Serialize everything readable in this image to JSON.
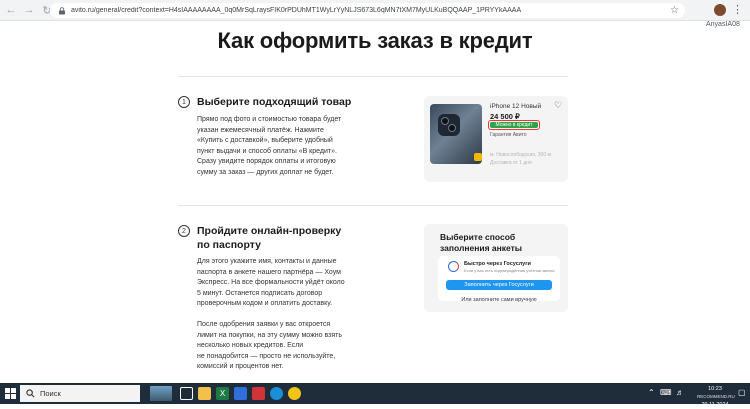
{
  "browser": {
    "url": "avito.ru/general/credit?context=H4sIAAAAAAAA_0q0MrSqLraysFIK0rPDUhMT1WyLrYyNLJS673L6qMN7tXM7MyULKuBQQAAP_1PRYYkAAAA",
    "profile_label": "AnyasIA08"
  },
  "page": {
    "title": "Как оформить заказ в кредит"
  },
  "steps": [
    {
      "number": "1",
      "title": "Выберите подходящий товар",
      "lines": [
        "Прямо под фото и стоимостью товара будет",
        "указан ежемесячный платёж. Нажмите",
        "«Купить с доставкой», выберите удобный",
        "пункт выдачи и способ оплаты «В кредит».",
        "Сразу увидите порядок оплаты и итоговую",
        "сумму за заказ — других доплат не будет."
      ]
    },
    {
      "number": "2",
      "title_lines": [
        "Пройдите онлайн-проверку",
        "по паспорту"
      ],
      "lines": [
        "Для этого укажите имя, контакты и данные",
        "паспорта в анкете нашего партнёра — Хоум",
        "Экспресс. На все формальности уйдёт около",
        "5 минут. Останется подписать договор",
        "проверочным кодом и оплатить доставку.",
        "",
        "После одобрения заявки у вас откроется",
        "лимит на покупки, на эту сумму можно взять",
        "несколько новых кредитов. Если",
        "не понадобится — просто не используйте,",
        "комиссий и процентов нет."
      ]
    }
  ],
  "product_card": {
    "name": "iPhone 12 Новый",
    "price": "24 500 ₽",
    "badge": "Можно в кредит",
    "guarantee": "Гарантия Авито",
    "faded_1": "м. Новослободская, 300 м",
    "faded_2": "Доставка от 1 дня"
  },
  "form_card": {
    "title_lines": [
      "Выберите способ",
      "заполнения анкеты"
    ],
    "gosuslugi_title": "Быстро через Госуслуги",
    "gosuslugi_sub": "Если у вас есть подтверждённая учётная запись",
    "gosuslugi_button": "Заполнить через Госуслуги",
    "manual_option": "Или заполните сами вручную"
  },
  "taskbar": {
    "search_placeholder": "Поиск",
    "clock_time": "10:23",
    "clock_date": "29.11.2024",
    "watermark": "RECOMMEND.RU"
  }
}
